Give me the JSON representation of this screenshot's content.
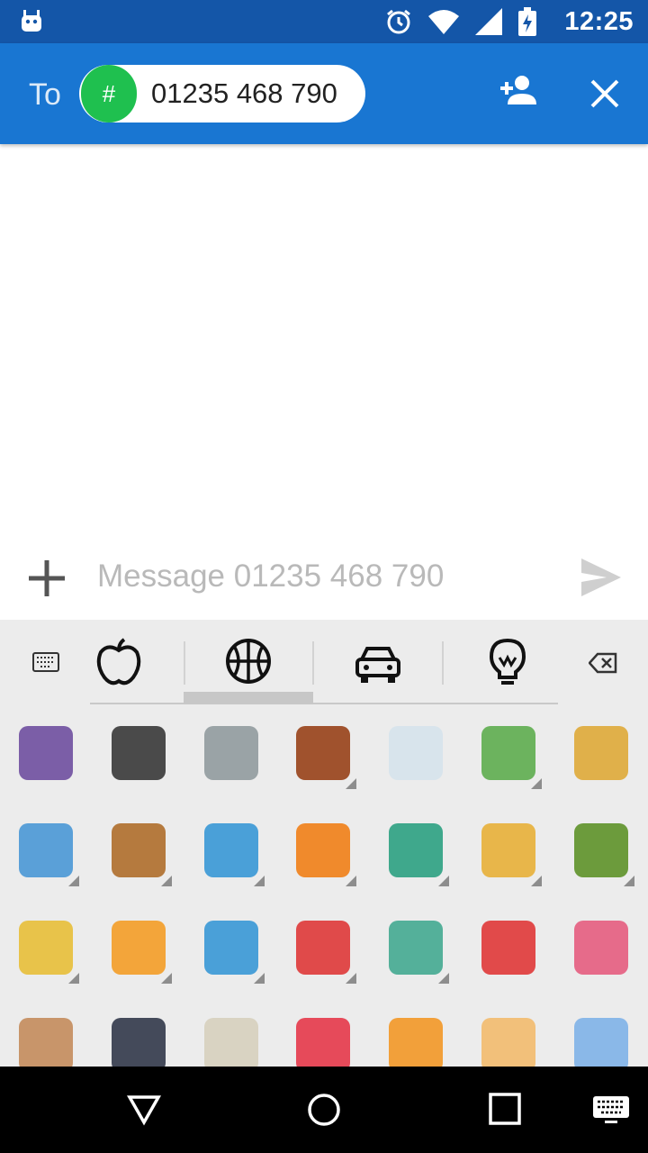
{
  "status_bar": {
    "time": "12:25",
    "icons": [
      "android-robot-icon",
      "alarm-icon",
      "wifi-icon",
      "signal-icon",
      "battery-charging-icon"
    ]
  },
  "app_bar": {
    "to_label": "To",
    "recipient": {
      "avatar_text": "#",
      "avatar_color": "#1fc04f",
      "number": "01235 468 790"
    },
    "add_person_icon": "person-add-icon",
    "close_icon": "close-icon",
    "color": "#1976d2"
  },
  "compose": {
    "placeholder": "Message 01235 468 790",
    "add_icon": "plus-icon",
    "send_icon": "send-icon"
  },
  "emoji_keyboard": {
    "tabs": [
      {
        "name": "keyboard",
        "icon": "keyboard-icon"
      },
      {
        "name": "food",
        "icon": "apple-icon"
      },
      {
        "name": "activities",
        "icon": "basketball-icon",
        "selected": true
      },
      {
        "name": "travel",
        "icon": "car-icon"
      },
      {
        "name": "objects",
        "icon": "lightbulb-icon"
      },
      {
        "name": "backspace",
        "icon": "backspace-icon"
      }
    ],
    "emojis": [
      {
        "name": "alien-monster-emoji",
        "color": "#7b5ea7",
        "variants": false
      },
      {
        "name": "man-in-business-suit-levitating-emoji",
        "color": "#4a4a4a",
        "variants": false
      },
      {
        "name": "fencer-emoji",
        "color": "#9aa3a6",
        "variants": false
      },
      {
        "name": "horse-racing-emoji",
        "color": "#a0522d",
        "variants": true
      },
      {
        "name": "skier-emoji",
        "color": "#d8e4ec",
        "variants": false
      },
      {
        "name": "snowboarder-emoji",
        "color": "#6cb35e",
        "variants": true
      },
      {
        "name": "golfer-emoji",
        "color": "#e0b04a",
        "variants": false
      },
      {
        "name": "surfer-emoji",
        "color": "#5aa0d8",
        "variants": true
      },
      {
        "name": "rowboat-emoji",
        "color": "#b57a3e",
        "variants": true
      },
      {
        "name": "swimmer-emoji",
        "color": "#4aa0d8",
        "variants": true
      },
      {
        "name": "person-bouncing-ball-emoji",
        "color": "#f08a2c",
        "variants": true
      },
      {
        "name": "weight-lifter-emoji",
        "color": "#3fa88c",
        "variants": true
      },
      {
        "name": "bicyclist-emoji",
        "color": "#e8b64a",
        "variants": true
      },
      {
        "name": "mountain-bicyclist-emoji",
        "color": "#6c9b3c",
        "variants": true
      },
      {
        "name": "person-doing-cartwheel-emoji",
        "color": "#e8c34a",
        "variants": true
      },
      {
        "name": "wrestlers-emoji",
        "color": "#f3a53a",
        "variants": true
      },
      {
        "name": "water-polo-emoji",
        "color": "#4aa0d8",
        "variants": true
      },
      {
        "name": "handball-emoji",
        "color": "#e04a4a",
        "variants": true
      },
      {
        "name": "juggling-emoji",
        "color": "#54b09a",
        "variants": true
      },
      {
        "name": "circus-tent-emoji",
        "color": "#e14a4a",
        "variants": false
      },
      {
        "name": "performing-arts-emoji",
        "color": "#e66b8a",
        "variants": false
      },
      {
        "name": "artist-palette-emoji",
        "color": "#c8956a",
        "variants": false
      },
      {
        "name": "slot-machine-emoji",
        "color": "#444a5a",
        "variants": false
      },
      {
        "name": "person-in-steamy-room-emoji",
        "color": "#d9d3c2",
        "variants": true
      },
      {
        "name": "reminder-ribbon-emoji",
        "color": "#e64a5a",
        "variants": false
      },
      {
        "name": "admission-tickets-emoji",
        "color": "#f2a03a",
        "variants": false
      },
      {
        "name": "ticket-emoji",
        "color": "#f2c07a",
        "variants": false
      },
      {
        "name": "military-medal-emoji",
        "color": "#8ab8e8",
        "variants": false
      }
    ]
  },
  "nav_bar": {
    "back_icon": "back-triangle-icon",
    "home_icon": "home-circle-icon",
    "recents_icon": "recents-square-icon",
    "keyboard_icon": "keyboard-switch-icon"
  }
}
